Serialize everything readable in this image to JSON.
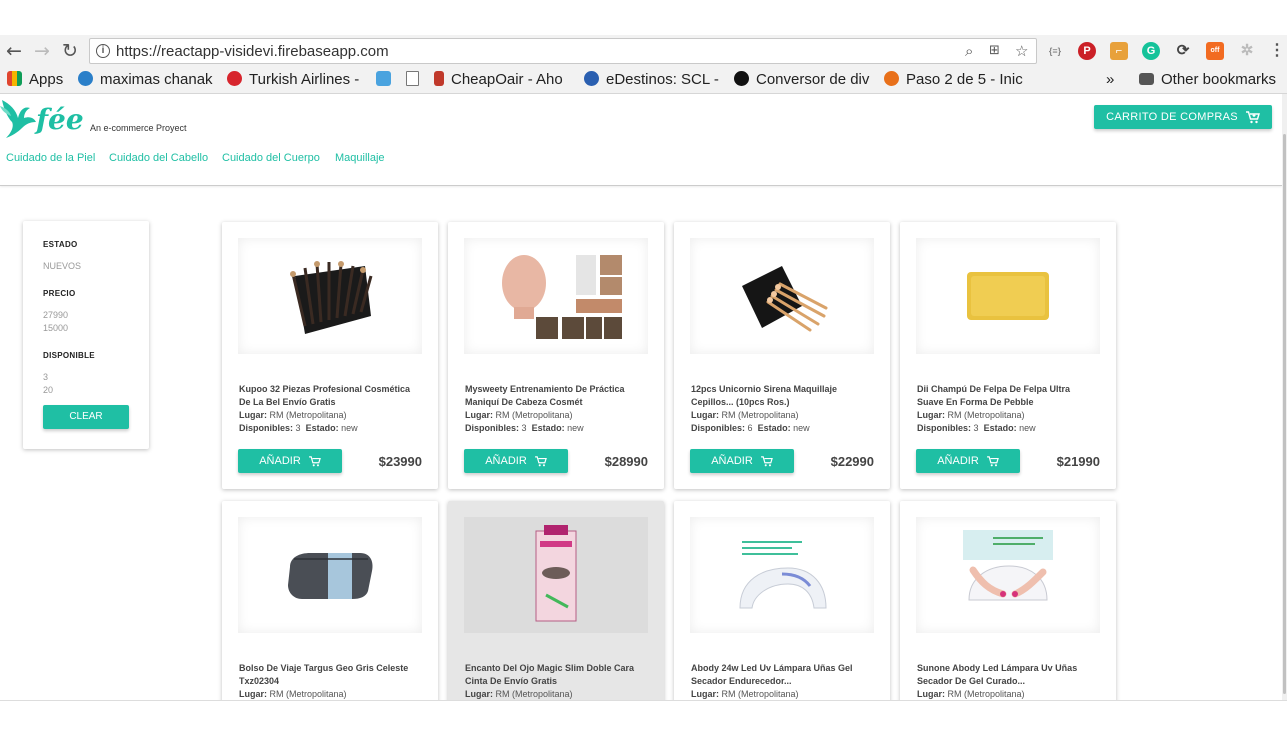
{
  "browser": {
    "url": "https://reactapp-visidevi.firebaseapp.com",
    "bookmarks": [
      {
        "label": "Apps",
        "color": "#e0452f"
      },
      {
        "label": "maximas chanak",
        "color": "#2a7fc9"
      },
      {
        "label": "Turkish Airlines -",
        "color": "#d7252d"
      },
      {
        "label": "",
        "color": "#4aa3df"
      },
      {
        "label": "",
        "color": "#ffffff"
      },
      {
        "label": "CheapOair - Aho",
        "color": "#c0392b"
      },
      {
        "label": "eDestinos: SCL -",
        "color": "#2a5fb0"
      },
      {
        "label": "Conversor de div",
        "color": "#111111"
      },
      {
        "label": "Paso 2 de 5 - Inic",
        "color": "#e8701a"
      }
    ],
    "more": "»",
    "other_bookmarks": "Other bookmarks"
  },
  "header": {
    "brand": "fée",
    "tagline": "An e-commerce Proyect",
    "cart_label": "CARRITO DE COMPRAS",
    "nav": [
      "Cuidado de la Piel",
      "Cuidado del Cabello",
      "Cuidado del Cuerpo",
      "Maquillaje"
    ],
    "accent": "#1fbfa4"
  },
  "filters": {
    "estado_title": "ESTADO",
    "estado_value": "NUEVOS",
    "precio_title": "PRECIO",
    "precio_values": [
      "27990",
      "15000"
    ],
    "disponible_title": "DISPONIBLE",
    "disponible_values": [
      "3",
      "20"
    ],
    "clear_label": "CLEAR"
  },
  "labels": {
    "lugar": "Lugar:",
    "disponibles": "Disponibles:",
    "estado": "Estado:",
    "add": "AÑADIR"
  },
  "products": [
    {
      "title": "Kupoo 32 Piezas Profesional Cosmética De La Bel Envío Gratis",
      "lugar": "RM (Metropolitana)",
      "disponibles": "3",
      "estado": "new",
      "price": "$23990",
      "image": "brush-set"
    },
    {
      "title": "Mysweety Entrenamiento De Práctica Maniquí De Cabeza Cosmét",
      "lugar": "RM (Metropolitana)",
      "disponibles": "3",
      "estado": "new",
      "price": "$28990",
      "image": "mannequin-head"
    },
    {
      "title": "12pcs Unicornio Sirena Maquillaje Cepillos... (10pcs Ros.)",
      "lugar": "RM (Metropolitana)",
      "disponibles": "6",
      "estado": "new",
      "price": "$22990",
      "image": "unicorn-brushes"
    },
    {
      "title": "Dii Champú De Felpa De Felpa Ultra Suave En Forma De Pebble",
      "lugar": "RM (Metropolitana)",
      "disponibles": "3",
      "estado": "new",
      "price": "$21990",
      "image": "yellow-mat"
    },
    {
      "title": "Bolso De Viaje Targus Geo Gris Celeste Txz02304",
      "lugar": "RM (Metropolitana)",
      "image": "travel-bag"
    },
    {
      "title": "Encanto Del Ojo Magic Slim Doble Cara Cinta De Envío Gratis",
      "lugar": "RM (Metropolitana)",
      "image": "eyelid-tape"
    },
    {
      "title": "Abody 24w Led Uv Lámpara Uñas Gel Secador Endurecedor...",
      "lugar": "RM (Metropolitana)",
      "image": "nail-lamp"
    },
    {
      "title": "Sunone Abody Led Lámpara Uv Uñas Secador De Gel Curado...",
      "lugar": "RM (Metropolitana)",
      "image": "nail-lamp-hands"
    }
  ]
}
